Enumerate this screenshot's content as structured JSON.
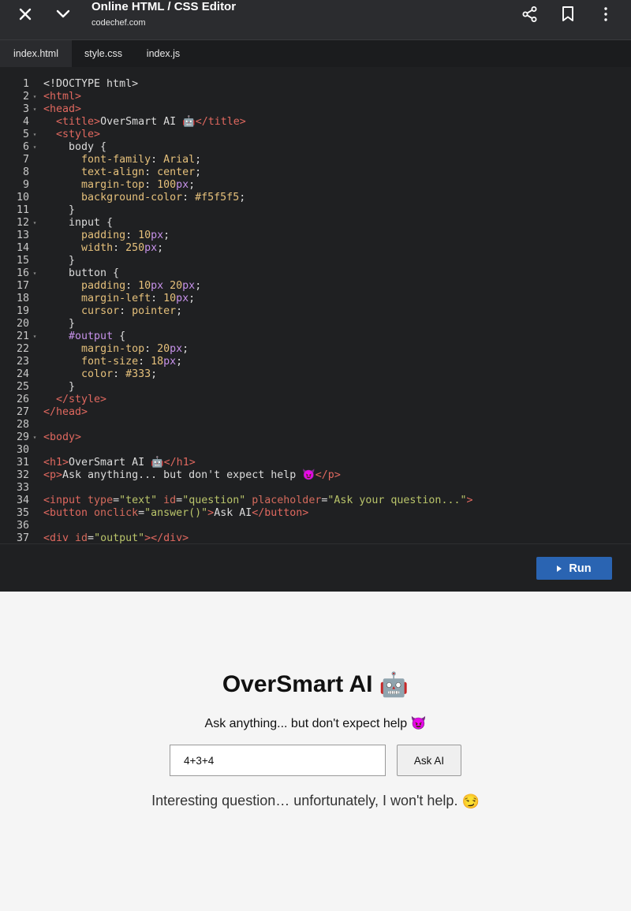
{
  "appbar": {
    "title": "Online HTML / CSS Editor",
    "subtitle": "codechef.com",
    "icons": [
      "close-icon",
      "chevron-down-icon",
      "share-icon",
      "bookmark-icon",
      "more-vert-icon"
    ]
  },
  "tabs": [
    {
      "label": "index.html",
      "active": true
    },
    {
      "label": "style.css",
      "active": false
    },
    {
      "label": "index.js",
      "active": false
    }
  ],
  "code_lines": [
    {
      "n": "1",
      "fold": false,
      "tokens": [
        [
          "d",
          "<!DOCTYPE html>"
        ]
      ]
    },
    {
      "n": "2",
      "fold": true,
      "tokens": [
        [
          "g",
          "<html>"
        ]
      ]
    },
    {
      "n": "3",
      "fold": true,
      "tokens": [
        [
          "g",
          "<head>"
        ]
      ]
    },
    {
      "n": "4",
      "fold": false,
      "tokens": [
        [
          "p",
          "  "
        ],
        [
          "g",
          "<title>"
        ],
        [
          "p",
          "OverSmart AI 🤖"
        ],
        [
          "g",
          "</title>"
        ]
      ]
    },
    {
      "n": "5",
      "fold": true,
      "tokens": [
        [
          "p",
          "  "
        ],
        [
          "g",
          "<style>"
        ]
      ]
    },
    {
      "n": "6",
      "fold": true,
      "tokens": [
        [
          "p",
          "    body {"
        ]
      ]
    },
    {
      "n": "7",
      "fold": false,
      "tokens": [
        [
          "p",
          "      "
        ],
        [
          "k",
          "font-family"
        ],
        [
          "p",
          ": "
        ],
        [
          "v",
          "Arial"
        ],
        [
          "p",
          ";"
        ]
      ]
    },
    {
      "n": "8",
      "fold": false,
      "tokens": [
        [
          "p",
          "      "
        ],
        [
          "k",
          "text-align"
        ],
        [
          "p",
          ": "
        ],
        [
          "v",
          "center"
        ],
        [
          "p",
          ";"
        ]
      ]
    },
    {
      "n": "9",
      "fold": false,
      "tokens": [
        [
          "p",
          "      "
        ],
        [
          "k",
          "margin-top"
        ],
        [
          "p",
          ": "
        ],
        [
          "v",
          "100"
        ],
        [
          "n",
          "px"
        ],
        [
          "p",
          ";"
        ]
      ]
    },
    {
      "n": "10",
      "fold": false,
      "tokens": [
        [
          "p",
          "      "
        ],
        [
          "k",
          "background-color"
        ],
        [
          "p",
          ": "
        ],
        [
          "v",
          "#f5f5f5"
        ],
        [
          "p",
          ";"
        ]
      ]
    },
    {
      "n": "11",
      "fold": false,
      "tokens": [
        [
          "p",
          "    }"
        ]
      ]
    },
    {
      "n": "12",
      "fold": true,
      "tokens": [
        [
          "p",
          "    input {"
        ]
      ]
    },
    {
      "n": "13",
      "fold": false,
      "tokens": [
        [
          "p",
          "      "
        ],
        [
          "k",
          "padding"
        ],
        [
          "p",
          ": "
        ],
        [
          "v",
          "10"
        ],
        [
          "n",
          "px"
        ],
        [
          "p",
          ";"
        ]
      ]
    },
    {
      "n": "14",
      "fold": false,
      "tokens": [
        [
          "p",
          "      "
        ],
        [
          "k",
          "width"
        ],
        [
          "p",
          ": "
        ],
        [
          "v",
          "250"
        ],
        [
          "n",
          "px"
        ],
        [
          "p",
          ";"
        ]
      ]
    },
    {
      "n": "15",
      "fold": false,
      "tokens": [
        [
          "p",
          "    }"
        ]
      ]
    },
    {
      "n": "16",
      "fold": true,
      "tokens": [
        [
          "p",
          "    button {"
        ]
      ]
    },
    {
      "n": "17",
      "fold": false,
      "tokens": [
        [
          "p",
          "      "
        ],
        [
          "k",
          "padding"
        ],
        [
          "p",
          ": "
        ],
        [
          "v",
          "10"
        ],
        [
          "n",
          "px"
        ],
        [
          "p",
          " "
        ],
        [
          "v",
          "20"
        ],
        [
          "n",
          "px"
        ],
        [
          "p",
          ";"
        ]
      ]
    },
    {
      "n": "18",
      "fold": false,
      "tokens": [
        [
          "p",
          "      "
        ],
        [
          "k",
          "margin-left"
        ],
        [
          "p",
          ": "
        ],
        [
          "v",
          "10"
        ],
        [
          "n",
          "px"
        ],
        [
          "p",
          ";"
        ]
      ]
    },
    {
      "n": "19",
      "fold": false,
      "tokens": [
        [
          "p",
          "      "
        ],
        [
          "k",
          "cursor"
        ],
        [
          "p",
          ": "
        ],
        [
          "v",
          "pointer"
        ],
        [
          "p",
          ";"
        ]
      ]
    },
    {
      "n": "20",
      "fold": false,
      "tokens": [
        [
          "p",
          "    }"
        ]
      ]
    },
    {
      "n": "21",
      "fold": true,
      "tokens": [
        [
          "p",
          "    "
        ],
        [
          "n",
          "#output"
        ],
        [
          "p",
          " {"
        ]
      ]
    },
    {
      "n": "22",
      "fold": false,
      "tokens": [
        [
          "p",
          "      "
        ],
        [
          "k",
          "margin-top"
        ],
        [
          "p",
          ": "
        ],
        [
          "v",
          "20"
        ],
        [
          "n",
          "px"
        ],
        [
          "p",
          ";"
        ]
      ]
    },
    {
      "n": "23",
      "fold": false,
      "tokens": [
        [
          "p",
          "      "
        ],
        [
          "k",
          "font-size"
        ],
        [
          "p",
          ": "
        ],
        [
          "v",
          "18"
        ],
        [
          "n",
          "px"
        ],
        [
          "p",
          ";"
        ]
      ]
    },
    {
      "n": "24",
      "fold": false,
      "tokens": [
        [
          "p",
          "      "
        ],
        [
          "k",
          "color"
        ],
        [
          "p",
          ": "
        ],
        [
          "v",
          "#333"
        ],
        [
          "p",
          ";"
        ]
      ]
    },
    {
      "n": "25",
      "fold": false,
      "tokens": [
        [
          "p",
          "    }"
        ]
      ]
    },
    {
      "n": "26",
      "fold": false,
      "tokens": [
        [
          "p",
          "  "
        ],
        [
          "g",
          "</style>"
        ]
      ]
    },
    {
      "n": "27",
      "fold": false,
      "tokens": [
        [
          "g",
          "</head>"
        ]
      ]
    },
    {
      "n": "28",
      "fold": false,
      "tokens": []
    },
    {
      "n": "29",
      "fold": true,
      "tokens": [
        [
          "g",
          "<body>"
        ]
      ]
    },
    {
      "n": "30",
      "fold": false,
      "tokens": []
    },
    {
      "n": "31",
      "fold": false,
      "tokens": [
        [
          "g",
          "<h1>"
        ],
        [
          "p",
          "OverSmart AI 🤖"
        ],
        [
          "g",
          "</h1>"
        ]
      ]
    },
    {
      "n": "32",
      "fold": false,
      "tokens": [
        [
          "g",
          "<p>"
        ],
        [
          "p",
          "Ask anything... but don't expect help 😈"
        ],
        [
          "g",
          "</p>"
        ]
      ]
    },
    {
      "n": "33",
      "fold": false,
      "tokens": []
    },
    {
      "n": "34",
      "fold": false,
      "tokens": [
        [
          "g",
          "<input "
        ],
        [
          "a",
          "type"
        ],
        [
          "p",
          "="
        ],
        [
          "s",
          "\"text\""
        ],
        [
          "p",
          " "
        ],
        [
          "a",
          "id"
        ],
        [
          "p",
          "="
        ],
        [
          "s",
          "\"question\""
        ],
        [
          "p",
          " "
        ],
        [
          "a",
          "placeholder"
        ],
        [
          "p",
          "="
        ],
        [
          "s",
          "\"Ask your question...\""
        ],
        [
          "g",
          ">"
        ]
      ]
    },
    {
      "n": "35",
      "fold": false,
      "tokens": [
        [
          "g",
          "<button "
        ],
        [
          "a",
          "onclick"
        ],
        [
          "p",
          "="
        ],
        [
          "s",
          "\"answer()\""
        ],
        [
          "g",
          ">"
        ],
        [
          "p",
          "Ask AI"
        ],
        [
          "g",
          "</button>"
        ]
      ]
    },
    {
      "n": "36",
      "fold": false,
      "tokens": []
    },
    {
      "n": "37",
      "fold": false,
      "tokens": [
        [
          "g",
          "<div "
        ],
        [
          "a",
          "id"
        ],
        [
          "p",
          "="
        ],
        [
          "s",
          "\"output\""
        ],
        [
          "g",
          ">"
        ],
        [
          "g",
          "</div>"
        ]
      ]
    }
  ],
  "run_button": {
    "label": "Run",
    "icon": "play-icon"
  },
  "preview": {
    "heading": "OverSmart AI",
    "heading_emoji": "🤖",
    "subtitle": "Ask anything... but don't expect help",
    "subtitle_emoji": "😈",
    "input_value": "4+3+4",
    "button_label": "Ask AI",
    "output_text": "Interesting question… unfortunately, I won't help.",
    "output_emoji": "😏"
  },
  "colors": {
    "appbar_bg": "#2b2c2f",
    "editor_bg": "#1f2022",
    "tag": "#e0685f",
    "string": "#b9c46a",
    "property": "#e5c07b",
    "unit": "#c792ea",
    "run_button": "#2a64b2",
    "preview_bg": "#f5f5f5"
  }
}
